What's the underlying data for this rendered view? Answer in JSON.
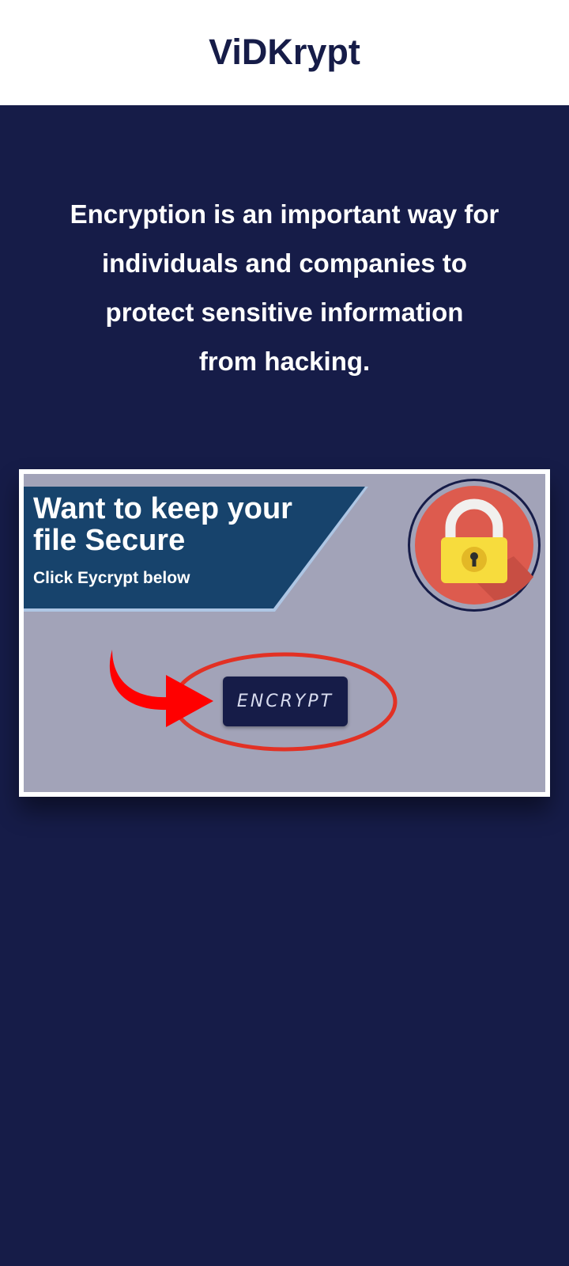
{
  "header": {
    "title": "ViDKrypt"
  },
  "main": {
    "tagline_lines": [
      "Encryption is an important way for",
      "individuals and companies to",
      "protect sensitive information",
      "from hacking."
    ]
  },
  "banner": {
    "headline_line1": "Want to keep your",
    "headline_line2": "file Secure",
    "subline": "Click Eycrypt below",
    "button_label": "ENCRYPT",
    "icons": [
      "lock-icon",
      "arrow-icon",
      "highlight-ellipse"
    ]
  },
  "colors": {
    "brand_navy": "#161c48",
    "banner_bg": "#a2a3b8",
    "ribbon_blue": "#17436c",
    "lock_circle_red": "#dd5b4e",
    "lock_yellow": "#f7dc3d",
    "arrow_red": "#ff0000",
    "ellipse_red": "#e23124"
  }
}
